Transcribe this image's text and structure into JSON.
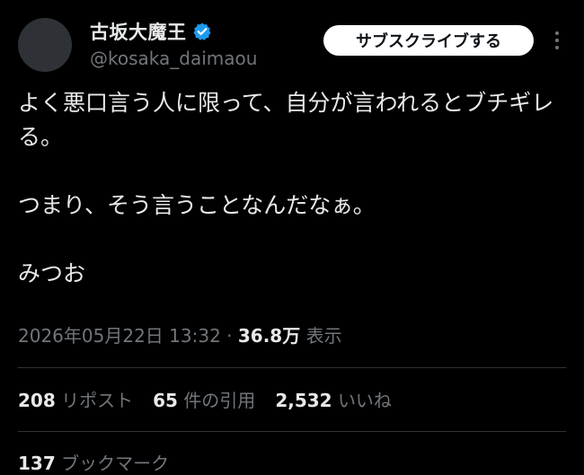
{
  "author": {
    "display_name": "古坂大魔王",
    "handle": "@kosaka_daimaou",
    "verified_icon": "verified-badge-icon",
    "verified_color": "#1d9bf0"
  },
  "header": {
    "subscribe_label": "サブスクライブする",
    "more_icon": "more-vertical-icon"
  },
  "tweet": {
    "paragraphs": [
      "よく悪口言う人に限って、自分が言われるとブチギレる。",
      "つまり、そう言うことなんだなぁ。",
      "みつお"
    ]
  },
  "meta": {
    "timestamp": "2026年05月22日 13:32",
    "separator": "·",
    "views_count": "36.8万",
    "views_label": "表示"
  },
  "stats": {
    "reposts_count": "208",
    "reposts_label": "リポスト",
    "quotes_count": "65",
    "quotes_label": "件の引用",
    "likes_count": "2,532",
    "likes_label": "いいね",
    "bookmarks_count": "137",
    "bookmarks_label": "ブックマーク"
  },
  "colors": {
    "background": "#000000",
    "text_primary": "#e7e9ea",
    "text_secondary": "#71767b",
    "divider": "#2f3336",
    "button_bg": "#ffffff"
  }
}
